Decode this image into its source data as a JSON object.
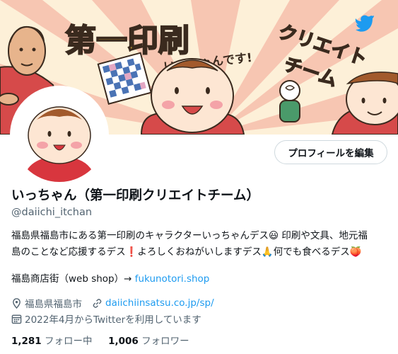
{
  "banner": {
    "title": "第一印刷",
    "subtitle_line1": "クリエイト",
    "subtitle_line2": "チーム",
    "tagline": "いっちゃんです!"
  },
  "profile": {
    "edit_button": "プロフィールを編集",
    "display_name": "いっちゃん（第一印刷クリエイトチーム）",
    "handle": "@daiichi_itchan",
    "bio_line1": "福島県福島市にある第一印刷のキャラクターいっちゃんデス😃 印刷や文具、地元福",
    "bio_line2": "島のことなど応援するデス❗️よろしくおねがいしますデス🙏何でも食べるデス🍑",
    "shop_label": "福島商店街（web shop）→ ",
    "shop_link": "fukunotori.shop",
    "location": "福島県福島市",
    "website": "daiichiinsatsu.co.jp/sp/",
    "joined": "2022年4月からTwitterを利用しています",
    "following_count": "1,281",
    "following_label": "フォロー中",
    "followers_count": "1,006",
    "followers_label": "フォロワー"
  },
  "icons": [
    "twitter-bird-icon",
    "location-pin-icon",
    "link-icon",
    "calendar-icon"
  ],
  "colors": {
    "accent": "#1d9bf0",
    "banner_bg": "#fdf0d8",
    "ray": "#f6b8a6",
    "title_yellow": "#f3c43f"
  }
}
